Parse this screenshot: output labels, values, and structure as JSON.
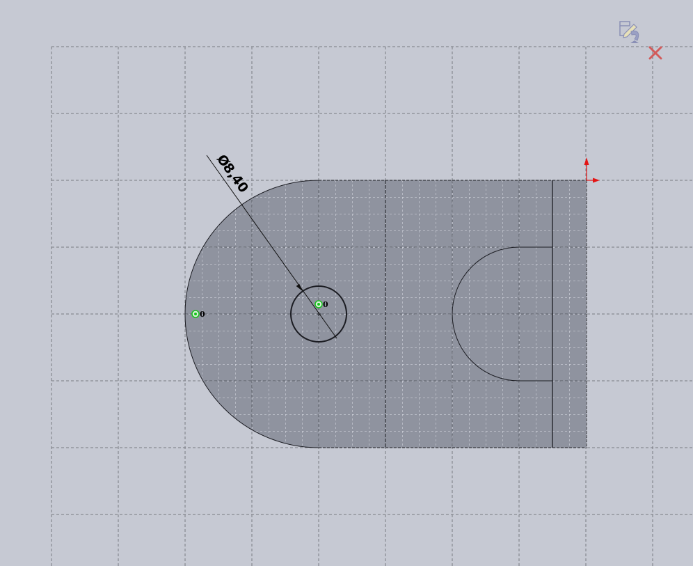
{
  "sketch": {
    "dimension": {
      "symbol": "Ø",
      "value": "8,40"
    },
    "relations": {
      "arc_center_label": "0",
      "hole_center_label": "0"
    }
  },
  "colors": {
    "background": "#c6c9d3",
    "grid": "#5e6068",
    "part_fill": "#8f939f",
    "part_edge": "#1b1c22",
    "dimension": "#111111",
    "origin_axis": "#e31414",
    "relation_icon": "#16c21b",
    "confirm_icon": "#8a8fb5",
    "cancel_icon": "#d25b5b"
  },
  "controls": {
    "confirm": "confirm-sketch-icon",
    "cancel": "cancel-sketch-icon"
  }
}
